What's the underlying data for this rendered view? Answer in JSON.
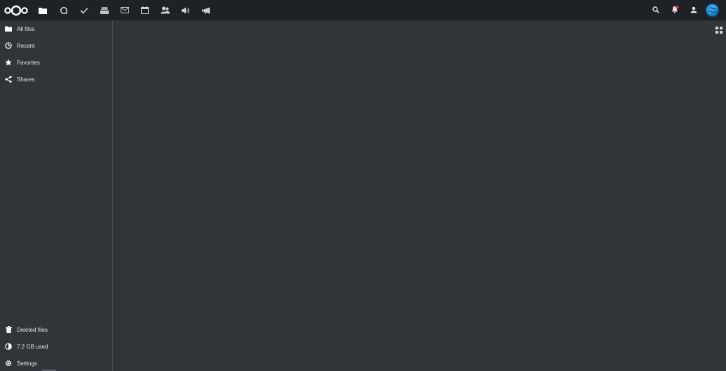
{
  "header": {
    "apps": [
      {
        "name": "files",
        "icon": "folder-icon"
      },
      {
        "name": "activity",
        "icon": "activity-icon"
      },
      {
        "name": "tasks",
        "icon": "checkmark-icon"
      },
      {
        "name": "deck",
        "icon": "stack-icon"
      },
      {
        "name": "mail",
        "icon": "mail-icon"
      },
      {
        "name": "calendar",
        "icon": "calendar-icon"
      },
      {
        "name": "contacts",
        "icon": "contacts-icon"
      },
      {
        "name": "talk",
        "icon": "speaker-icon"
      },
      {
        "name": "announcements",
        "icon": "megaphone-icon"
      }
    ],
    "right_icons": [
      "search-icon",
      "notifications-icon",
      "contacts-menu-icon",
      "user-avatar"
    ]
  },
  "sidebar": {
    "items": [
      {
        "label": "All files",
        "icon": "folder-icon"
      },
      {
        "label": "Recent",
        "icon": "clock-icon"
      },
      {
        "label": "Favorites",
        "icon": "star-icon"
      },
      {
        "label": "Shares",
        "icon": "share-icon"
      }
    ],
    "footer": [
      {
        "label": "Deleted files",
        "icon": "trash-icon"
      },
      {
        "label": "7.2 GB used",
        "icon": "pie-chart-icon"
      },
      {
        "label": "Settings",
        "icon": "gear-icon"
      }
    ]
  },
  "colors": {
    "header_bg": "#1e2125",
    "body_bg": "#31353a",
    "text": "#e6e6e6",
    "accent": "#1b86cf",
    "notification": "#e9322d"
  }
}
